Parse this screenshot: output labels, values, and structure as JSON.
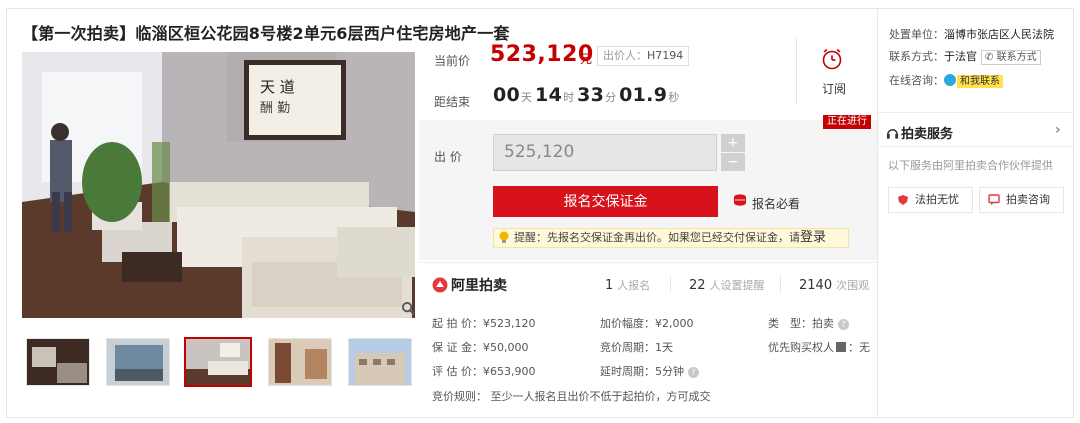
{
  "title": "【第一次拍卖】临淄区桓公花园8号楼2单元6层西户住宅房地产一套",
  "price": {
    "current_label": "当前价",
    "current_value": "523,120",
    "currency": "元",
    "bidder_label": "出价人：",
    "bidder_id": "H7194",
    "end_label": "距结束",
    "countdown": {
      "days": "00",
      "days_unit": "天",
      "hours": "14",
      "hours_unit": "时",
      "minutes": "33",
      "minutes_unit": "分",
      "seconds": "01.9",
      "seconds_unit": "秒"
    },
    "subscribe_label": "订阅"
  },
  "bid": {
    "status_badge": "正在进行",
    "bid_label": "出 价",
    "bid_value": "525,120",
    "plus": "+",
    "minus": "−",
    "signup_button": "报名交保证金",
    "must_read": "报名必看",
    "tip_text": "提醒：先报名交保证金再出价。如果您已经交付保证金，请",
    "tip_login": "登录"
  },
  "stats": {
    "brand": "阿里拍卖",
    "signups": "1",
    "signups_label": "人报名",
    "reminders": "22",
    "reminders_label": "人设置提醒",
    "views": "2140",
    "views_label": "次围观"
  },
  "details": {
    "start_price": "起 拍 价：¥523,120",
    "increment": "加价幅度：¥2,000",
    "type_label": "类　型：",
    "type_value": "拍卖",
    "deposit": "保 证 金：¥50,000",
    "cycle": "竞价周期：1天",
    "priority_label": "优先购买权人",
    "priority_value": "：无",
    "valuation": "评 估 价：¥653,900",
    "delay": "延时周期：5分钟",
    "rule": "竞价规则：   至少一人报名且出价不低于起拍价，方可成交"
  },
  "side": {
    "unit_label": "处置单位：",
    "unit_value": "淄博市张店区人民法院",
    "contact_label": "联系方式：",
    "contact_value": "于法官",
    "contact_button": "联系方式",
    "consult_label": "在线咨询：",
    "consult_badge": "和我联系",
    "service_title": "拍卖服务",
    "service_desc": "以下服务由阿里拍卖合作伙伴提供",
    "service_1": "法拍无忧",
    "service_2": "拍卖咨询"
  },
  "colors": {
    "accent_red": "#c40000",
    "button_red": "#d8121a",
    "tip_bg": "#fff8d9"
  }
}
